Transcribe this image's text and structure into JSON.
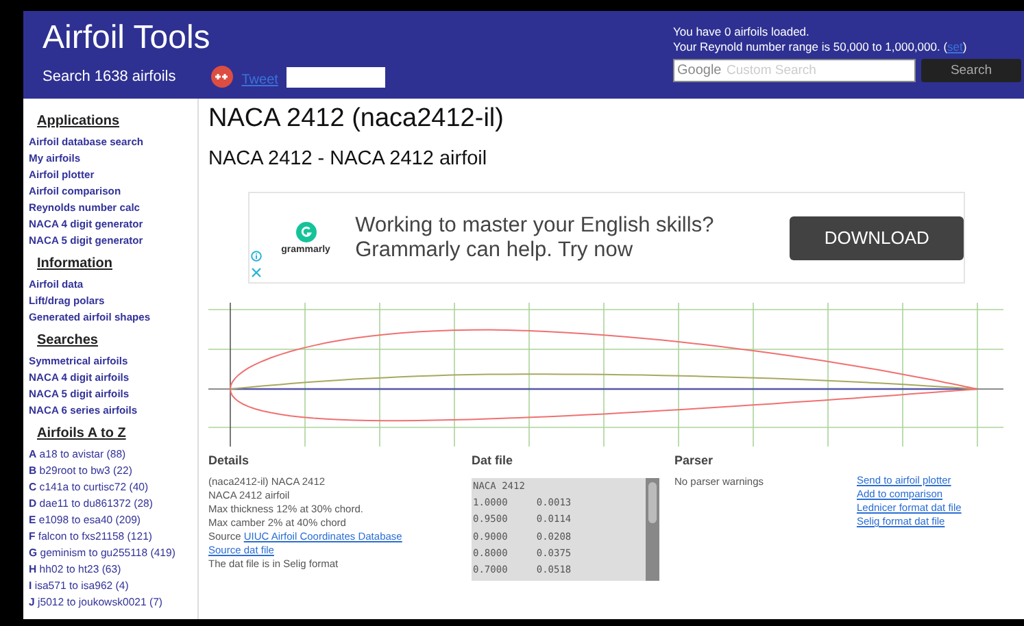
{
  "header": {
    "title": "Airfoil Tools",
    "subtitle": "Search 1638 airfoils",
    "tweet": "Tweet",
    "loaded": "You have 0 airfoils loaded.",
    "reynolds": "Your Reynold number range is 50,000 to 1,000,000. (",
    "reynolds_link": "set",
    "reynolds_end": ")",
    "search_brand": "Google",
    "search_placeholder": "Custom Search",
    "search_button": "Search"
  },
  "sidebar": [
    {
      "heading": "Applications",
      "items": [
        "Airfoil database search",
        "My airfoils",
        "Airfoil plotter",
        "Airfoil comparison",
        "Reynolds number calc",
        "NACA 4 digit generator",
        "NACA 5 digit generator"
      ]
    },
    {
      "heading": "Information",
      "items": [
        "Airfoil data",
        "Lift/drag polars",
        "Generated airfoil shapes"
      ]
    },
    {
      "heading": "Searches",
      "items": [
        "Symmetrical airfoils",
        "NACA 4 digit airfoils",
        "NACA 5 digit airfoils",
        "NACA 6 series airfoils"
      ]
    },
    {
      "heading": "Airfoils A to Z",
      "kind": "az",
      "items": [
        "**A** a18 to avistar (88)",
        "**B** b29root to bw3 (22)",
        "**C** c141a to curtisc72 (40)",
        "**D** dae11 to du861372 (28)",
        "**E** e1098 to esa40 (209)",
        "**F** falcon to fxs21158 (121)",
        "**G** geminism to gu255118 (419)",
        "**H** hh02 to ht23 (63)",
        "**I** isa571 to isa962 (4)",
        "**J** j5012 to joukowsk0021 (7)"
      ]
    }
  ],
  "main": {
    "title": "NACA 2412 (naca2412-il)",
    "subtitle": "NACA 2412 - NACA 2412 airfoil"
  },
  "ad": {
    "brand": "grammarly",
    "text_lines": [
      "Working to master your English skills?",
      "Grammarly can help. Try now"
    ],
    "button": "DOWNLOAD"
  },
  "details": {
    "heading": "Details",
    "lines": [
      {
        "text": "(naca2412-il) NACA 2412"
      },
      {
        "text": "NACA 2412 airfoil"
      },
      {
        "text": "Max thickness 12% at 30% chord."
      },
      {
        "text": "Max camber 2% at 40% chord"
      },
      {
        "text": "Source ",
        "link": "UIUC Airfoil Coordinates Database"
      },
      {
        "link": "Source dat file"
      },
      {
        "text": "The dat file is in Selig format"
      }
    ]
  },
  "dat_file": {
    "heading": "Dat file",
    "lines": [
      "NACA 2412",
      "1.0000     0.0013",
      "0.9500     0.0114",
      "0.9000     0.0208",
      "0.8000     0.0375",
      "0.7000     0.0518"
    ]
  },
  "parser": {
    "heading": "Parser",
    "message": "No parser warnings",
    "links": [
      "Send to airfoil plotter",
      "Add to comparison",
      "Lednicer format dat file",
      "Selig format dat file"
    ]
  }
}
